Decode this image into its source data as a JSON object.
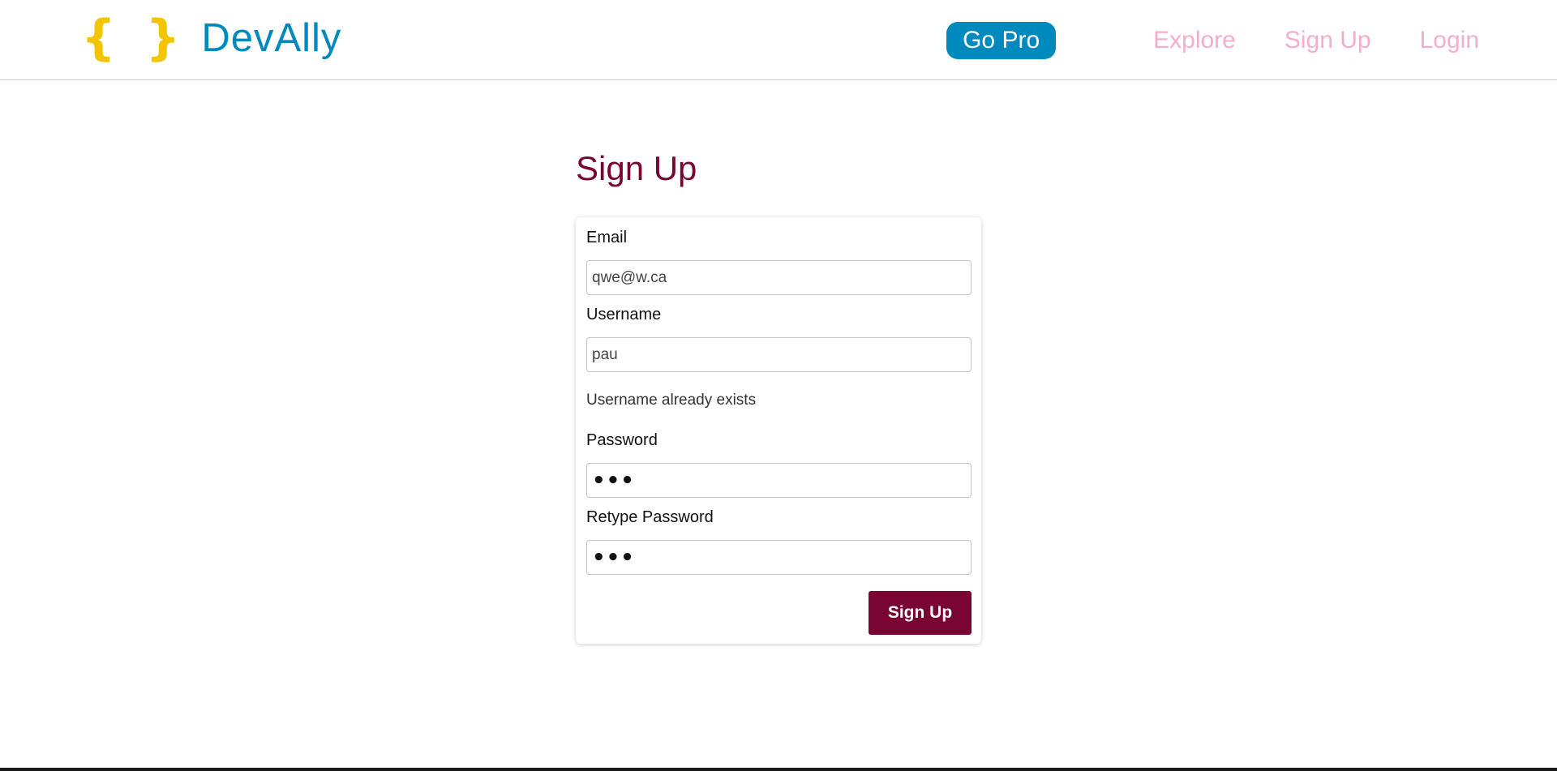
{
  "brand": {
    "icon": "{ }",
    "icon_name": "curly-braces-icon",
    "name": "DevAlly"
  },
  "nav": {
    "go_pro": "Go Pro",
    "explore": "Explore",
    "sign_up": "Sign Up",
    "login": "Login"
  },
  "form": {
    "title": "Sign Up",
    "email_label": "Email",
    "email_value": "qwe@w.ca",
    "username_label": "Username",
    "username_value": "pau",
    "username_error": "Username already exists",
    "password_label": "Password",
    "password_value": "•••",
    "retype_password_label": "Retype Password",
    "retype_password_value": "•••",
    "submit_label": "Sign Up"
  },
  "colors": {
    "brand_blue": "#0089bd",
    "brand_yellow": "#f3c400",
    "nav_pink": "#f4aecb",
    "accent_maroon": "#7a0532"
  }
}
